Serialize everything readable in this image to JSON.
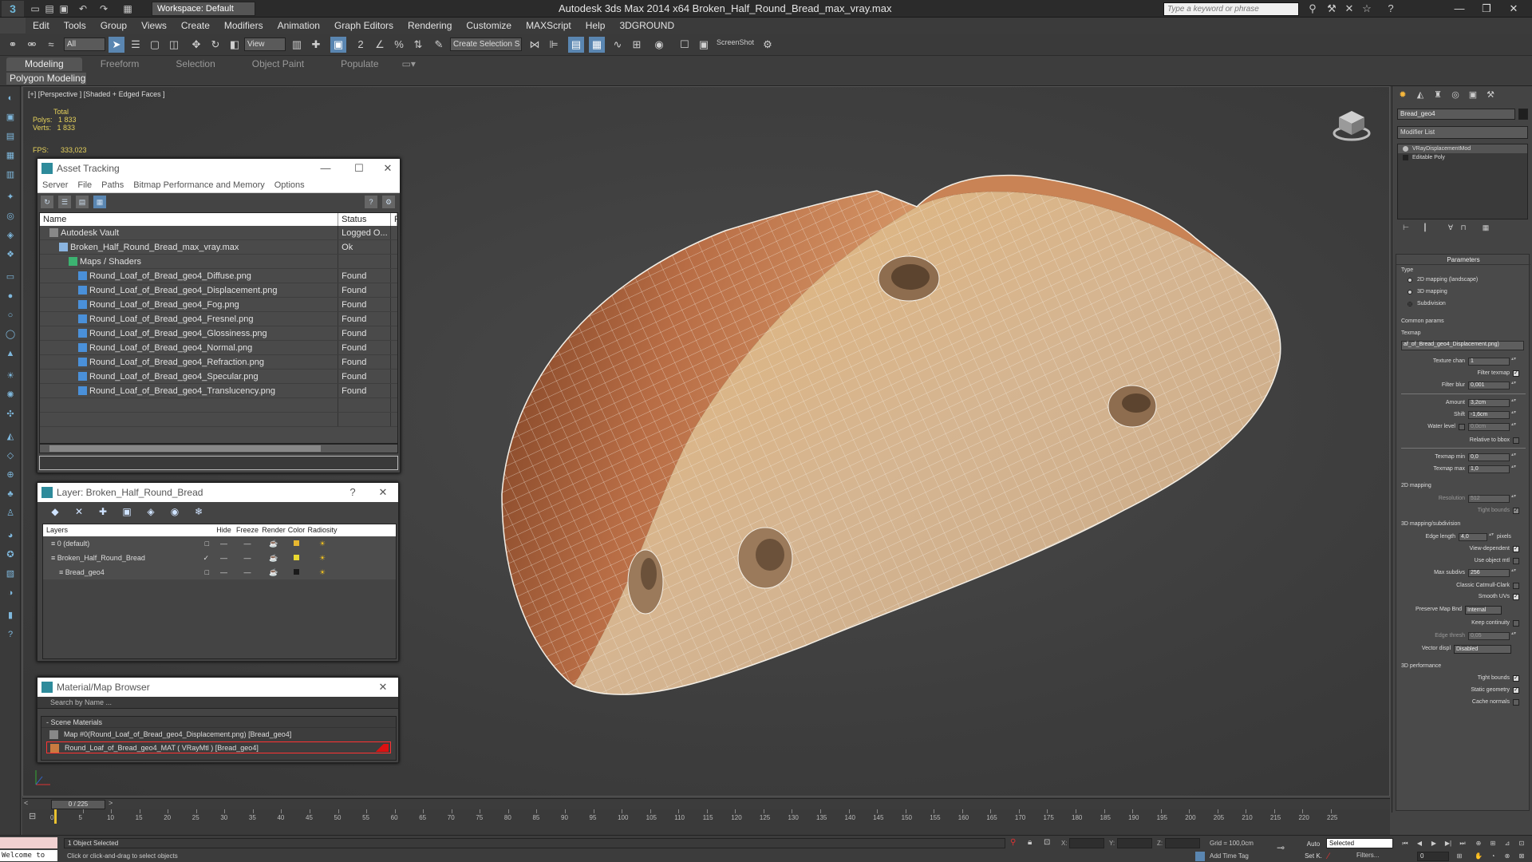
{
  "titlebar": {
    "workspace": "Workspace: Default",
    "window_title": "Autodesk 3ds Max  2014 x64      Broken_Half_Round_Bread_max_vray.max",
    "search_placeholder": "Type a keyword or phrase",
    "controls": [
      "—",
      "❐",
      "✕"
    ]
  },
  "menubar": [
    "Edit",
    "Tools",
    "Group",
    "Views",
    "Create",
    "Modifiers",
    "Animation",
    "Graph Editors",
    "Rendering",
    "Customize",
    "MAXScript",
    "Help",
    "3DGROUND"
  ],
  "toolbar": {
    "selection_filter": "All",
    "ref_coord": "View",
    "named_selection": "Create Selection S",
    "screenshot_label": "ScreenShot"
  },
  "ribbon": {
    "tabs": [
      "Modeling",
      "Freeform",
      "Selection",
      "Object Paint",
      "Populate"
    ],
    "active_tab": "Modeling",
    "panel": "Polygon Modeling"
  },
  "viewport": {
    "label": "[+] [Perspective ] [Shaded + Edged Faces ]",
    "stats": {
      "total_label": "Total",
      "polys_label": "Polys:",
      "polys": "1 833",
      "verts_label": "Verts:",
      "verts": "1 833",
      "fps_label": "FPS:",
      "fps": "333,023"
    }
  },
  "asset_tracking": {
    "title": "Asset Tracking",
    "menu": [
      "Server",
      "File",
      "Paths",
      "Bitmap Performance and Memory",
      "Options"
    ],
    "columns": [
      "Name",
      "Status",
      "P"
    ],
    "rows": [
      {
        "name": "Autodesk Vault",
        "status": "Logged O...",
        "indent": 1,
        "icon": "vault"
      },
      {
        "name": "Broken_Half_Round_Bread_max_vray.max",
        "status": "Ok",
        "indent": 2,
        "icon": "file"
      },
      {
        "name": "Maps / Shaders",
        "status": "",
        "indent": 3,
        "icon": "maps"
      },
      {
        "name": "Round_Loaf_of_Bread_geo4_Diffuse.png",
        "status": "Found",
        "indent": 4,
        "icon": "image"
      },
      {
        "name": "Round_Loaf_of_Bread_geo4_Displacement.png",
        "status": "Found",
        "indent": 4,
        "icon": "image"
      },
      {
        "name": "Round_Loaf_of_Bread_geo4_Fog.png",
        "status": "Found",
        "indent": 4,
        "icon": "image"
      },
      {
        "name": "Round_Loaf_of_Bread_geo4_Fresnel.png",
        "status": "Found",
        "indent": 4,
        "icon": "image"
      },
      {
        "name": "Round_Loaf_of_Bread_geo4_Glossiness.png",
        "status": "Found",
        "indent": 4,
        "icon": "image"
      },
      {
        "name": "Round_Loaf_of_Bread_geo4_Normal.png",
        "status": "Found",
        "indent": 4,
        "icon": "image"
      },
      {
        "name": "Round_Loaf_of_Bread_geo4_Refraction.png",
        "status": "Found",
        "indent": 4,
        "icon": "image"
      },
      {
        "name": "Round_Loaf_of_Bread_geo4_Specular.png",
        "status": "Found",
        "indent": 4,
        "icon": "image"
      },
      {
        "name": "Round_Loaf_of_Bread_geo4_Translucency.png",
        "status": "Found",
        "indent": 4,
        "icon": "image"
      }
    ]
  },
  "layer_dialog": {
    "title": "Layer: Broken_Half_Round_Bread",
    "columns": [
      "Layers",
      "Hide",
      "Freeze",
      "Render",
      "Color",
      "Radiosity"
    ],
    "rows": [
      {
        "name": "0 (default)",
        "indent": 1,
        "color": "#e8b830",
        "current": false
      },
      {
        "name": "Broken_Half_Round_Bread",
        "indent": 1,
        "color": "#e8d830",
        "current": true
      },
      {
        "name": "Bread_geo4",
        "indent": 2,
        "color": "#1a1a1a",
        "current": false
      }
    ]
  },
  "material_browser": {
    "title": "Material/Map Browser",
    "search_placeholder": "Search by Name ...",
    "section": "- Scene Materials",
    "items": [
      "Map #0(Round_Loaf_of_Bread_geo4_Displacement.png) [Bread_geo4]",
      "Round_Loaf_of_Bread_geo4_MAT ( VRayMtl ) [Bread_geo4]"
    ]
  },
  "command_panel": {
    "object_name": "Bread_geo4",
    "modifier_list": "Modifier List",
    "stack": [
      "VRayDisplacementMod",
      "Editable Poly"
    ],
    "rollout_title": "Parameters",
    "type_group": "Type",
    "type_options": [
      "2D mapping (landscape)",
      "3D mapping",
      "Subdivision"
    ],
    "type_selected": "Subdivision",
    "common_group": "Common params",
    "texmap_label": "Texmap",
    "texmap_value": "af_of_Bread_geo4_Displacement.png)",
    "texture_chan_label": "Texture chan",
    "texture_chan": "1",
    "filter_texmap_label": "Filter texmap",
    "filter_blur_label": "Filter blur",
    "filter_blur": "0,001",
    "amount_label": "Amount",
    "amount": "3,2cm",
    "shift_label": "Shift",
    "shift": "-1,6cm",
    "water_level_label": "Water level",
    "water_level": "0,0cm",
    "relative_bbox_label": "Relative to bbox",
    "texmap_min_label": "Texmap min",
    "texmap_min": "0,0",
    "texmap_max_label": "Texmap max",
    "texmap_max": "1,0",
    "map2d_group": "2D mapping",
    "resolution_label": "Resolution",
    "resolution": "512",
    "tight_bounds_label": "Tight bounds",
    "sub_group": "3D mapping/subdivision",
    "edge_length_label": "Edge length",
    "edge_length": "4,0",
    "pixels_label": "pixels",
    "view_dependent_label": "View-dependent",
    "use_object_mtl_label": "Use object mtl",
    "max_subdivs_label": "Max subdivs",
    "max_subdivs": "256",
    "catmull_label": "Classic Catmull-Clark",
    "smooth_uvs_label": "Smooth UVs",
    "preserve_label": "Preserve Map Bnd",
    "preserve_value": "Internal",
    "keep_continuity_label": "Keep continuity",
    "edge_thresh_label": "Edge thresh",
    "edge_thresh": "0,05",
    "vector_displ_label": "Vector displ",
    "vector_displ": "Disabled",
    "perf_group": "3D performance",
    "tight_bounds2_label": "Tight bounds",
    "static_geo_label": "Static geometry",
    "cache_normals_label": "Cache normals"
  },
  "timeline": {
    "slider": "0 / 225",
    "ticks": [
      0,
      5,
      10,
      15,
      20,
      25,
      30,
      35,
      40,
      45,
      50,
      55,
      60,
      65,
      70,
      75,
      80,
      85,
      90,
      95,
      100,
      105,
      110,
      115,
      120,
      125,
      130,
      135,
      140,
      145,
      150,
      155,
      160,
      165,
      170,
      175,
      180,
      185,
      190,
      195,
      200,
      205,
      210,
      215,
      220,
      225
    ],
    "max_frame": 225
  },
  "statusbar": {
    "maxscript": "Welcome to",
    "selected": "1 Object Selected",
    "prompt": "Click or click-and-drag to select objects",
    "x_label": "X:",
    "y_label": "Y:",
    "z_label": "Z:",
    "grid": "Grid = 100,0cm",
    "add_time_tag": "Add Time Tag",
    "auto": "Auto",
    "set_k": "Set K.",
    "selected_dropdown": "Selected",
    "filters": "Filters...",
    "frame": "0"
  }
}
